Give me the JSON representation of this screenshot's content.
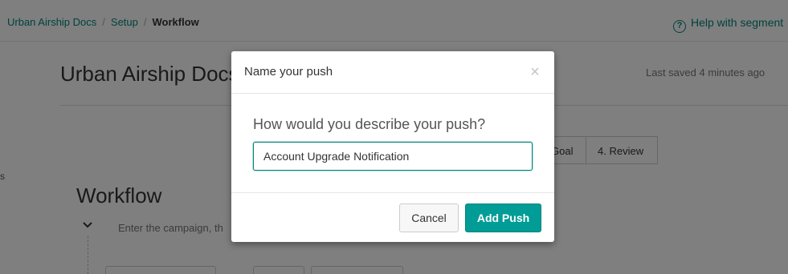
{
  "breadcrumb": {
    "items": [
      "Urban Airship Docs",
      "Setup",
      "Workflow"
    ],
    "separator": "/"
  },
  "help": {
    "label": "Help with segment",
    "icon": "question-circle-icon"
  },
  "page": {
    "title": "Urban Airship Docs",
    "last_saved": "Last saved 4 minutes ago",
    "steps": [
      "Goal",
      "4. Review"
    ],
    "side_text": "s",
    "workflow": {
      "heading": "Workflow",
      "description": "Enter the campaign, th",
      "chevron_icon": "chevron-down-icon"
    }
  },
  "modal": {
    "title": "Name your push",
    "close_icon": "close-icon",
    "close_glyph": "×",
    "prompt": "How would you describe your push?",
    "input_value": "Account Upgrade Notification",
    "cancel_label": "Cancel",
    "submit_label": "Add Push"
  },
  "colors": {
    "accent": "#00857c",
    "primary_button": "#009c95",
    "backdrop": "rgba(0,0,0,0.5)"
  }
}
